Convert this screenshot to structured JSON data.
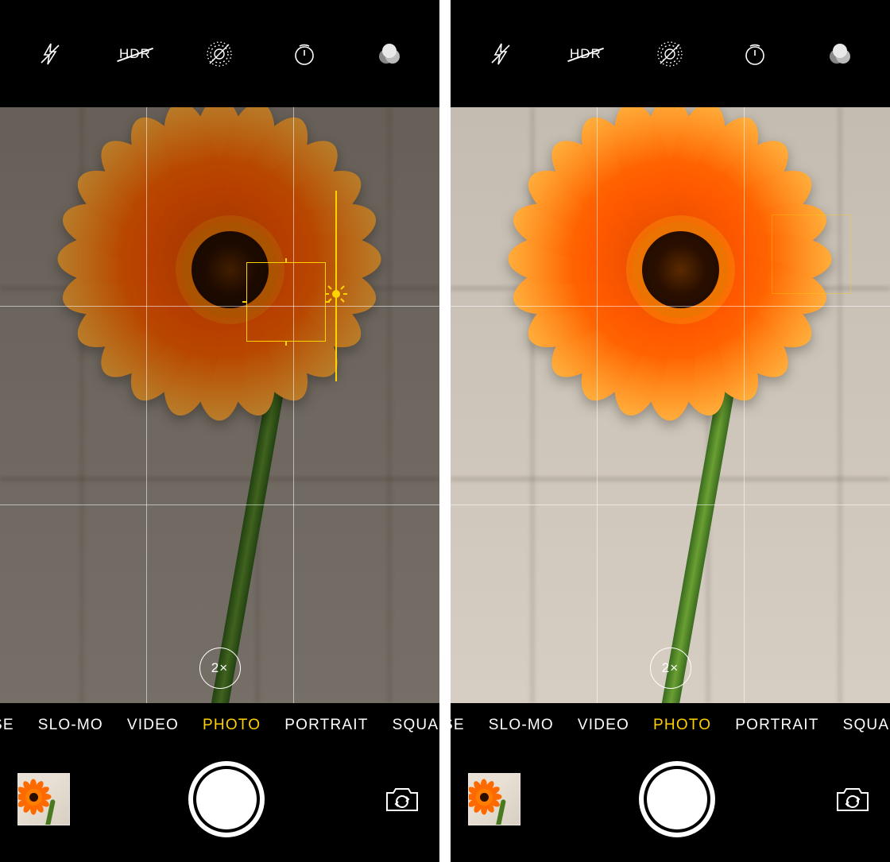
{
  "shared": {
    "hdr_label": "HDR",
    "zoom_label": "2×",
    "modes": {
      "clipped_left": "SE",
      "items": [
        "SLO-MO",
        "VIDEO",
        "PHOTO",
        "PORTRAIT",
        "SQUARE"
      ],
      "active": "PHOTO"
    }
  },
  "left": {
    "exposure_reduced": true,
    "focus_visible": true,
    "exposure_slider_visible": true,
    "grid_visible": true
  },
  "right": {
    "exposure_reduced": false,
    "focus_visible_faint": true,
    "grid_visible": true
  }
}
